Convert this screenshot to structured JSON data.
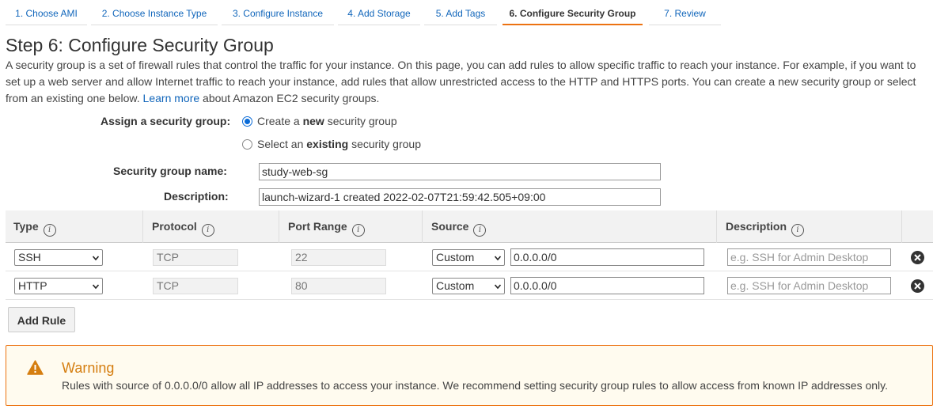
{
  "wizard": {
    "steps": [
      {
        "label": "1. Choose AMI"
      },
      {
        "label": "2. Choose Instance Type"
      },
      {
        "label": "3. Configure Instance"
      },
      {
        "label": "4. Add Storage"
      },
      {
        "label": "5. Add Tags"
      },
      {
        "label": "6. Configure Security Group"
      },
      {
        "label": "7. Review"
      }
    ],
    "active_step": "6. Configure Security Group"
  },
  "page": {
    "title": "Step 6: Configure Security Group",
    "intro_text": "A security group is a set of firewall rules that control the traffic for your instance. On this page, you can add rules to allow specific traffic to reach your instance. For example, if you want to set up a web server and allow Internet traffic to reach your instance, add rules that allow unrestricted access to the HTTP and HTTPS ports. You can create a new security group or select from an existing one below.",
    "learn_more": "Learn more",
    "learn_more_suffix": "about Amazon EC2 security groups."
  },
  "assign": {
    "label": "Assign a security group:",
    "option_new": {
      "prefix": "Create a",
      "bold": "new",
      "suffix": "security group",
      "selected": true
    },
    "option_existing": {
      "prefix": "Select an",
      "bold": "existing",
      "suffix": "security group",
      "selected": false
    }
  },
  "form": {
    "name_label": "Security group name:",
    "name_value": "study-web-sg",
    "desc_label": "Description:",
    "desc_value": "launch-wizard-1 created 2022-02-07T21:59:42.505+09:00"
  },
  "table": {
    "headers": {
      "type": "Type",
      "protocol": "Protocol",
      "port_range": "Port Range",
      "source": "Source",
      "description": "Description"
    },
    "info_glyph": "i",
    "rows": [
      {
        "type": "SSH",
        "protocol": "TCP",
        "port_range": "22",
        "source": "Custom",
        "cidr": "0.0.0.0/0",
        "description_placeholder": "e.g. SSH for Admin Desktop"
      },
      {
        "type": "HTTP",
        "protocol": "TCP",
        "port_range": "80",
        "source": "Custom",
        "cidr": "0.0.0.0/0",
        "description_placeholder": "e.g. SSH for Admin Desktop"
      }
    ]
  },
  "add_rule_label": "Add Rule",
  "warning": {
    "title": "Warning",
    "text": "Rules with source of 0.0.0.0/0 allow all IP addresses to access your instance. We recommend setting security group rules to allow access from known IP addresses only."
  },
  "colors": {
    "accent_orange": "#ec7211",
    "link_blue": "#1166bb",
    "warning_bg": "#fffbef",
    "warning_title": "#d57e10"
  }
}
